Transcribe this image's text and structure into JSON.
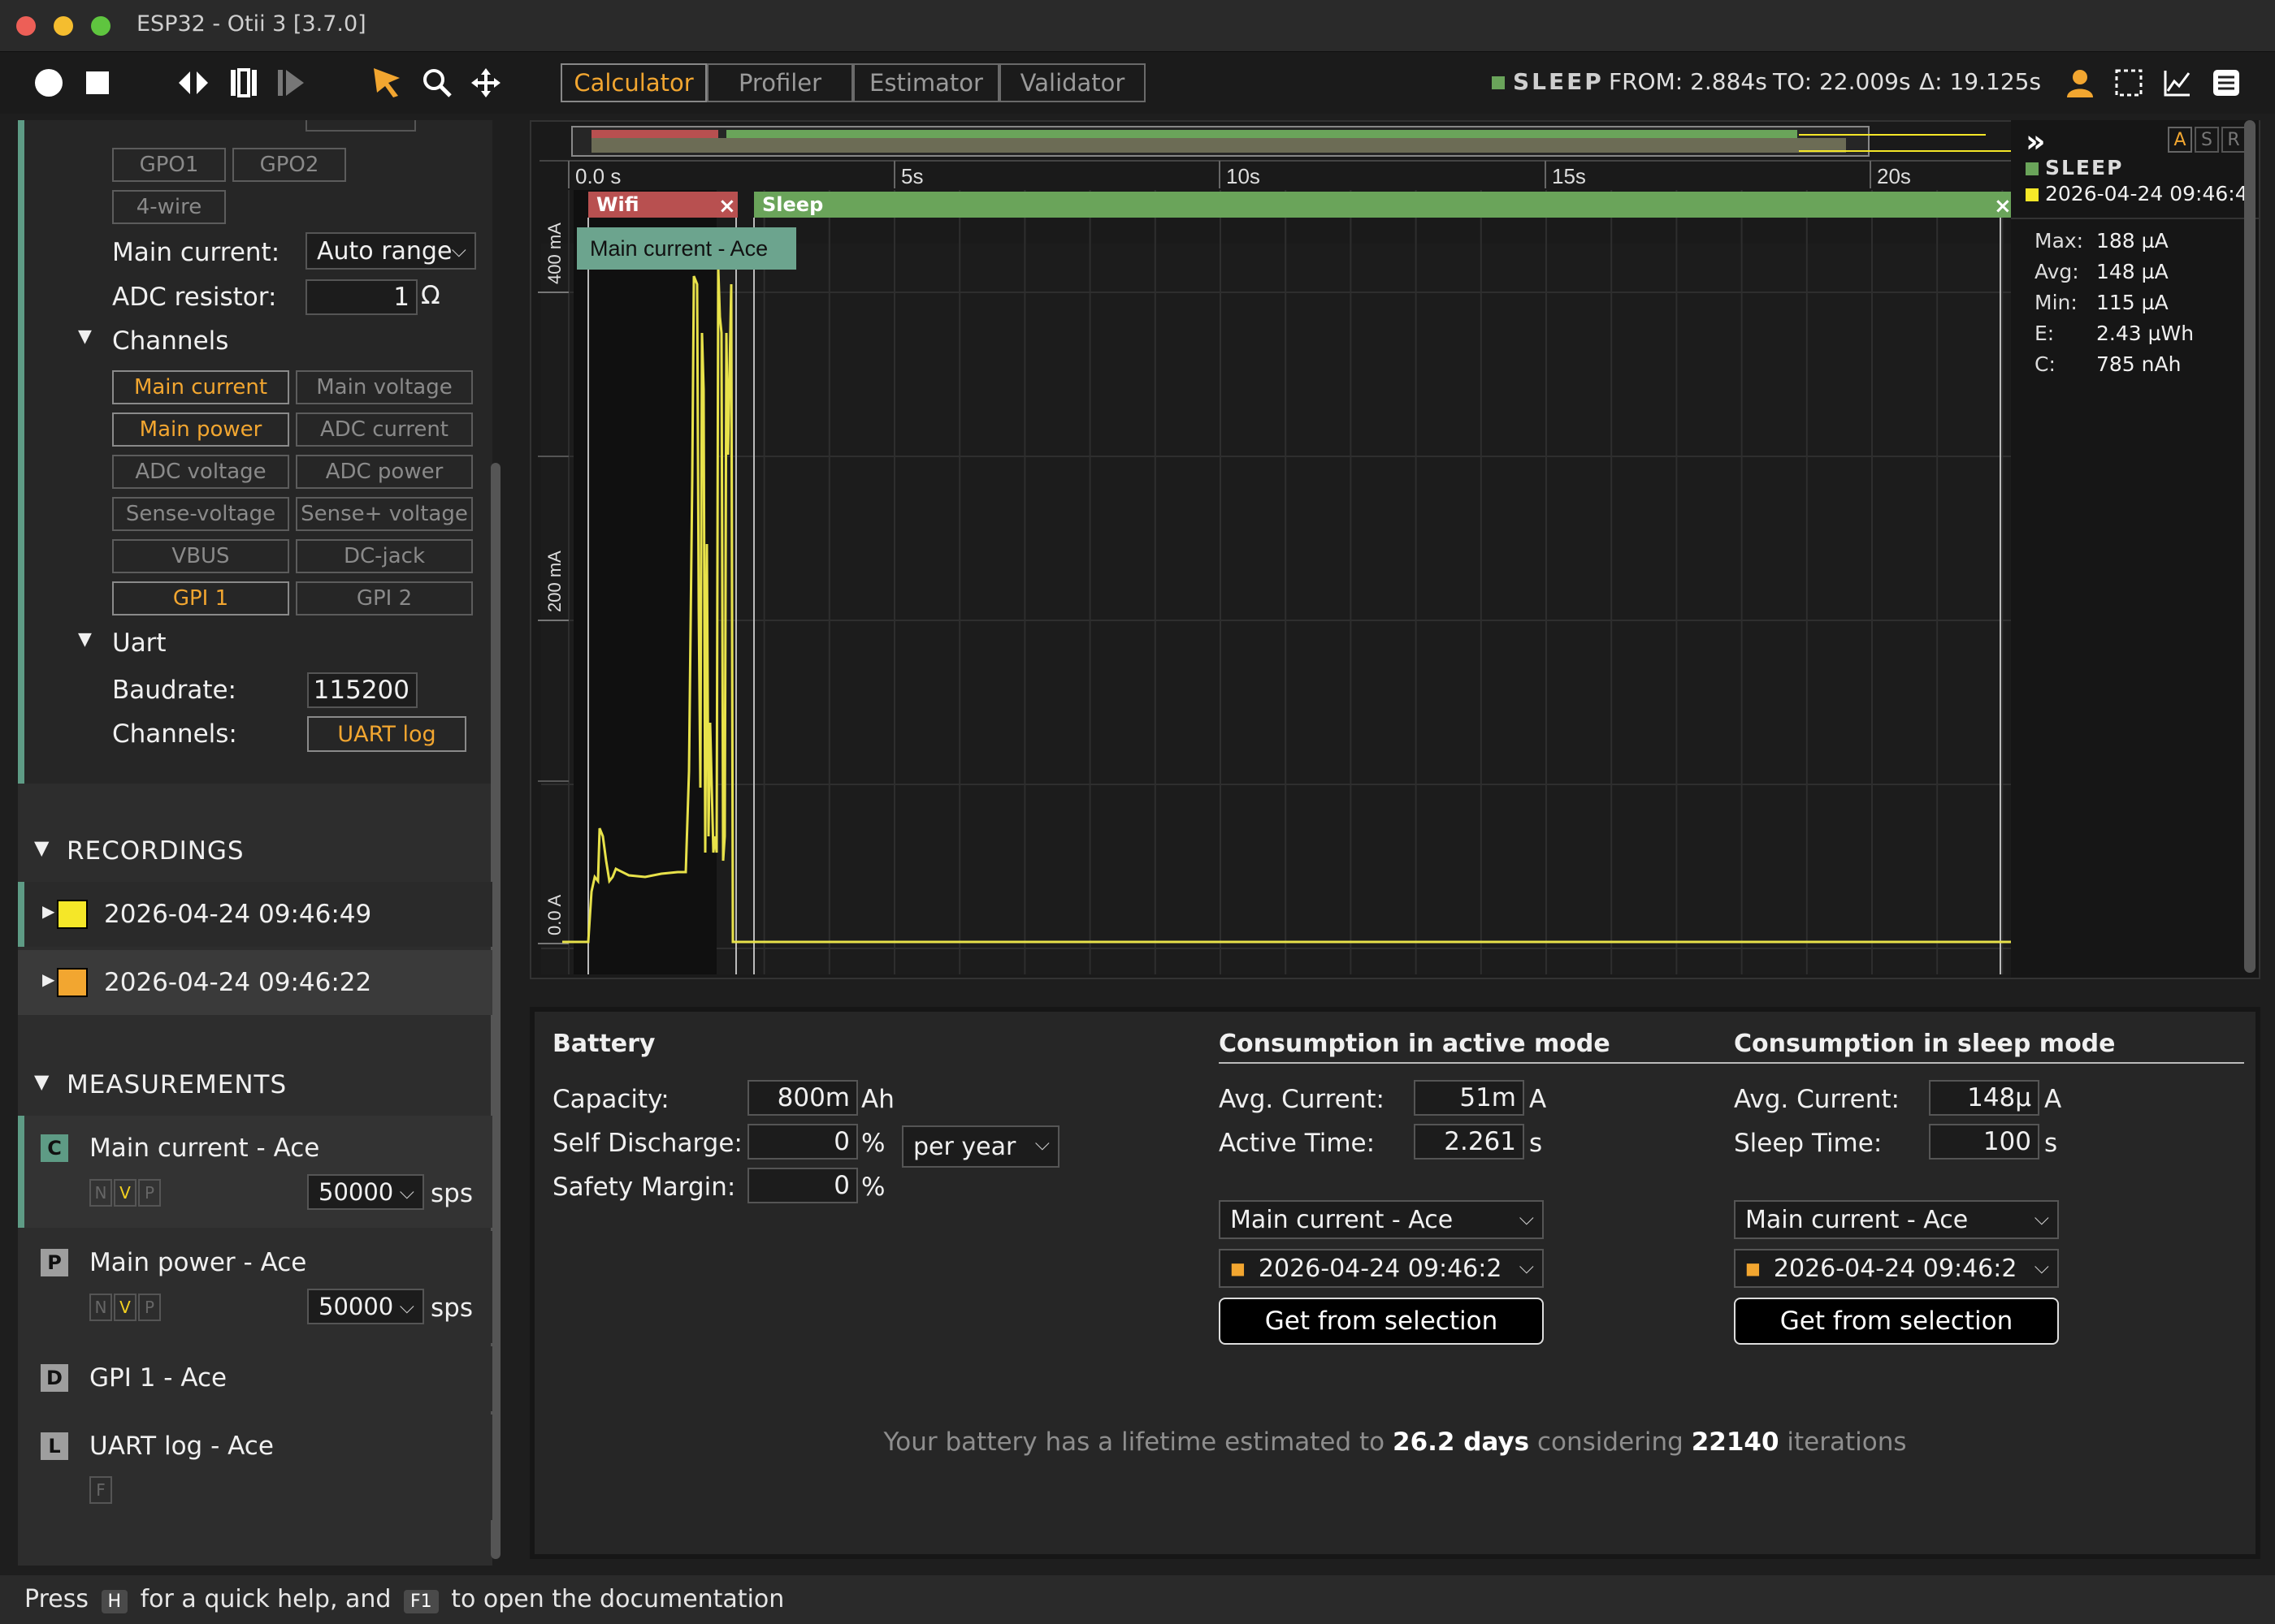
{
  "window": {
    "title": "ESP32 - Otii 3 [3.7.0]"
  },
  "tabs": [
    "Calculator",
    "Profiler",
    "Estimator",
    "Validator"
  ],
  "status": {
    "state": "SLEEP",
    "from": "FROM: 2.884s",
    "to": "TO: 22.009s",
    "delta": "Δ: 19.125s"
  },
  "device": {
    "gpo": [
      "GPO1",
      "GPO2",
      "4-wire"
    ],
    "main_current_label": "Main current:",
    "main_current_value": "Auto range",
    "adc_resistor_label": "ADC resistor:",
    "adc_resistor_value": "1",
    "adc_resistor_unit": "Ω",
    "channels_label": "Channels",
    "channels": [
      {
        "label": "Main current",
        "on": true
      },
      {
        "label": "Main voltage",
        "on": false
      },
      {
        "label": "Main power",
        "on": true
      },
      {
        "label": "ADC current",
        "on": false
      },
      {
        "label": "ADC voltage",
        "on": false
      },
      {
        "label": "ADC power",
        "on": false
      },
      {
        "label": "Sense-voltage",
        "on": false
      },
      {
        "label": "Sense+ voltage",
        "on": false
      },
      {
        "label": "VBUS",
        "on": false
      },
      {
        "label": "DC-jack",
        "on": false
      },
      {
        "label": "GPI 1",
        "on": true
      },
      {
        "label": "GPI 2",
        "on": false
      }
    ],
    "uart_label": "Uart",
    "baudrate_label": "Baudrate:",
    "baudrate_value": "115200",
    "uart_channels_label": "Channels:",
    "uart_channel_value": "UART log"
  },
  "recordings": {
    "header": "RECORDINGS",
    "items": [
      {
        "name": "2026-04-24 09:46:49",
        "color": "#f5e728"
      },
      {
        "name": "2026-04-24 09:46:22",
        "color": "#f2a630"
      }
    ]
  },
  "measurements": {
    "header": "MEASUREMENTS",
    "items": [
      {
        "badge": "C",
        "name": "Main current - Ace",
        "sps": "50000",
        "unit": "sps",
        "nvp": [
          "N",
          "V",
          "P"
        ],
        "badge_color": "#5e9b85"
      },
      {
        "badge": "P",
        "name": "Main power - Ace",
        "sps": "50000",
        "unit": "sps",
        "nvp": [
          "N",
          "V",
          "P"
        ],
        "badge_color": "#9e9e9e"
      },
      {
        "badge": "D",
        "name": "GPI 1 - Ace",
        "badge_color": "#9e9e9e"
      },
      {
        "badge": "L",
        "name": "UART log - Ace",
        "extra": "F",
        "badge_color": "#9e9e9e"
      }
    ]
  },
  "chart": {
    "x_ticks": [
      "0.0 s",
      "5s",
      "10s",
      "15s",
      "20s"
    ],
    "y_ticks": [
      "400 mA",
      "200 mA",
      "0.0 A"
    ],
    "markers": [
      {
        "label": "Wifi",
        "color": "#b85050"
      },
      {
        "label": "Sleep",
        "color": "#6aa45a"
      }
    ],
    "tooltip": "Main current - Ace",
    "panel_icon": "»",
    "asr": [
      "A",
      "S",
      "R"
    ],
    "legend": [
      {
        "label": "SLEEP",
        "color": "#6aa45a"
      },
      {
        "label": "2026-04-24 09:46:4",
        "color": "#f5e728"
      }
    ],
    "stats": [
      {
        "k": "Max:",
        "v": "188 µA"
      },
      {
        "k": "Avg:",
        "v": "148 µA"
      },
      {
        "k": "Min:",
        "v": "115 µA"
      },
      {
        "k": "E:",
        "v": "2.43 µWh"
      },
      {
        "k": "C:",
        "v": "785 nAh"
      }
    ]
  },
  "calculator": {
    "battery": {
      "title": "Battery",
      "capacity_label": "Capacity:",
      "capacity": "800m",
      "capacity_unit": "Ah",
      "self_discharge_label": "Self Discharge:",
      "self_discharge": "0",
      "self_discharge_unit": "%",
      "period": "per year",
      "safety_label": "Safety Margin:",
      "safety": "0",
      "safety_unit": "%"
    },
    "active": {
      "title": "Consumption in active mode",
      "avg_label": "Avg. Current:",
      "avg": "51m",
      "avg_unit": "A",
      "time_label": "Active Time:",
      "time": "2.261",
      "time_unit": "s",
      "channel": "Main current - Ace",
      "recording": "2026-04-24 09:46:2",
      "button": "Get from selection"
    },
    "sleep": {
      "title": "Consumption in sleep mode",
      "avg_label": "Avg. Current:",
      "avg": "148µ",
      "avg_unit": "A",
      "time_label": "Sleep Time:",
      "time": "100",
      "time_unit": "s",
      "channel": "Main current - Ace",
      "recording": "2026-04-24 09:46:2",
      "button": "Get from selection"
    },
    "result": {
      "prefix": "Your battery has a lifetime estimated to",
      "days": "26.2 days",
      "middle": "considering",
      "iterations": "22140",
      "suffix": "iterations"
    }
  },
  "footer": {
    "press": "Press",
    "key1": "H",
    "mid": "for a quick help, and",
    "key2": "F1",
    "end": "to open the documentation"
  }
}
